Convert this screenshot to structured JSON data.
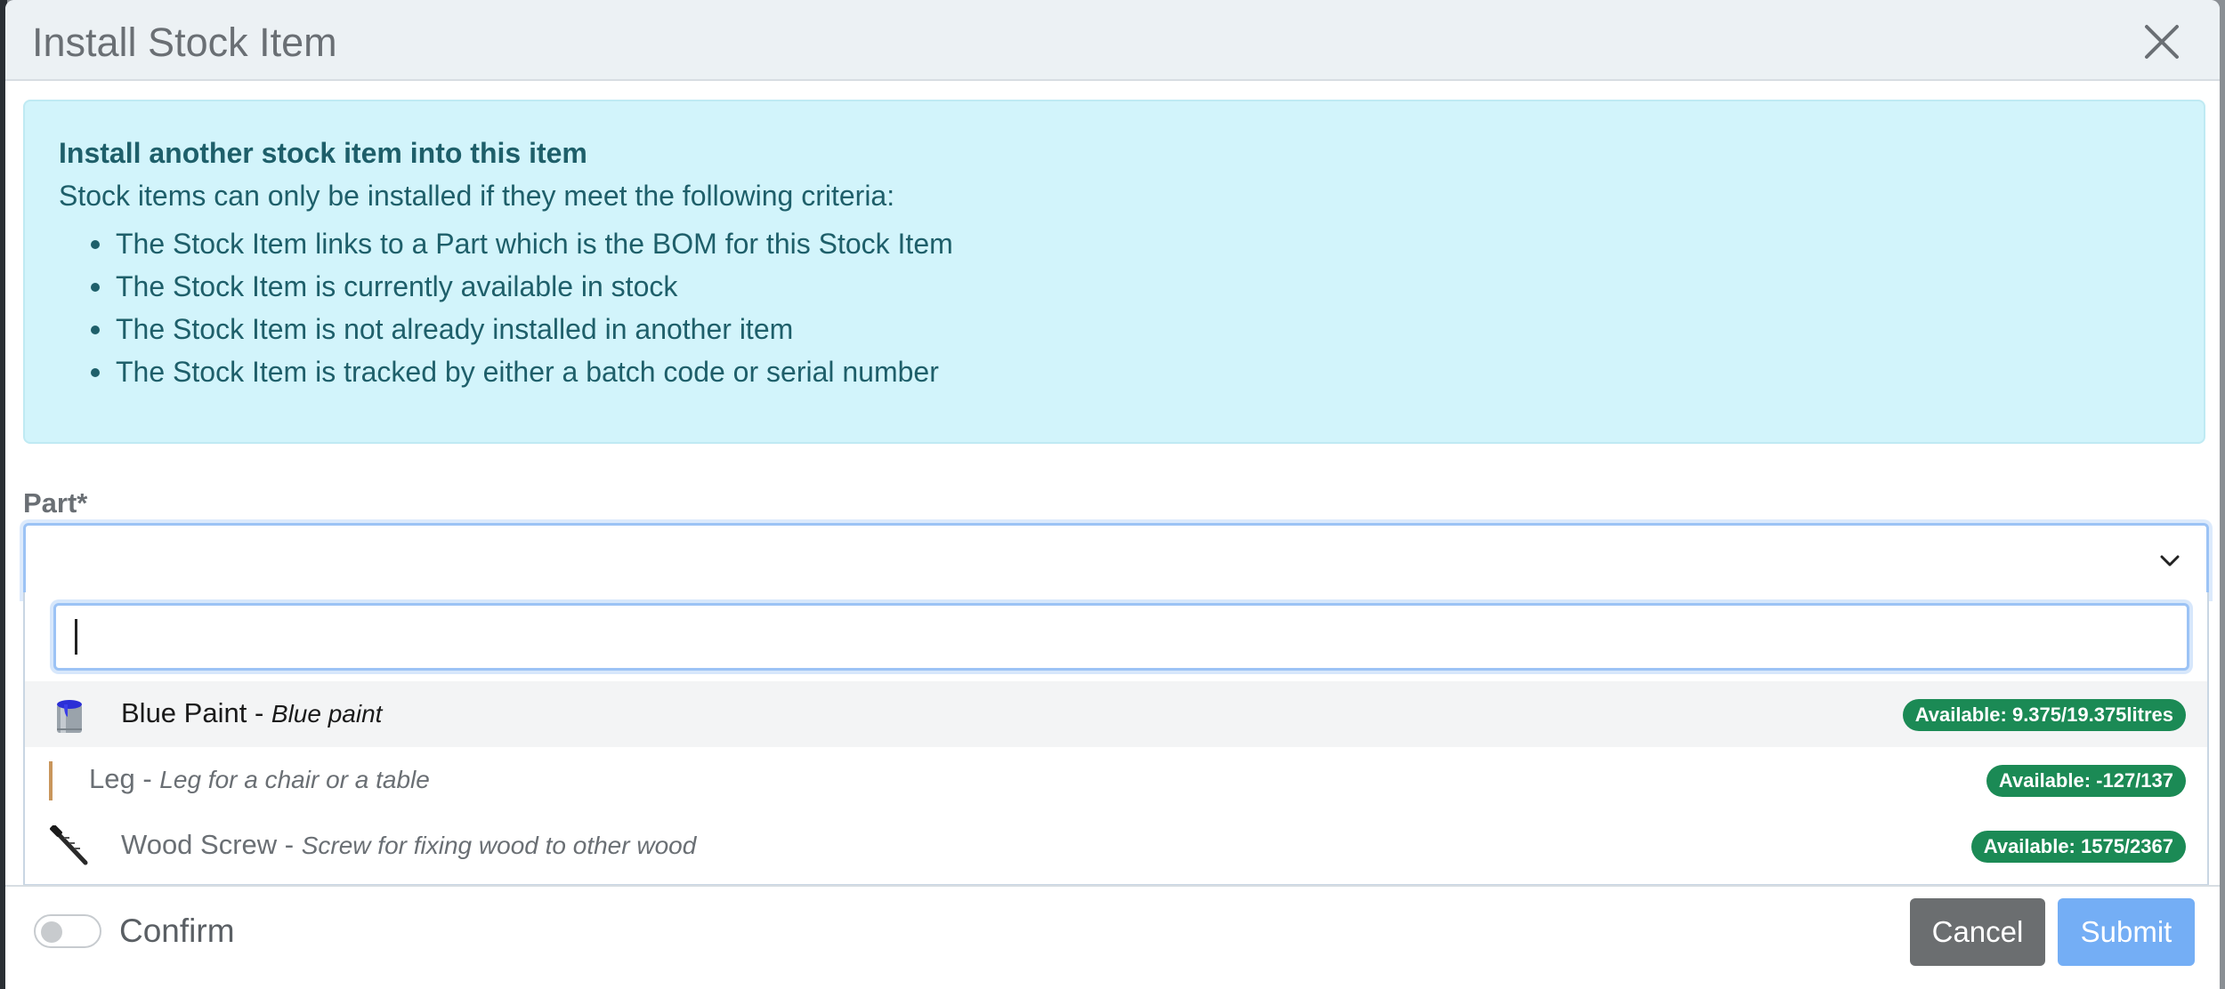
{
  "modal": {
    "title": "Install Stock Item"
  },
  "info": {
    "heading": "Install another stock item into this item",
    "intro": "Stock items can only be installed if they meet the following criteria:",
    "criteria": [
      "The Stock Item links to a Part which is the BOM for this Stock Item",
      "The Stock Item is currently available in stock",
      "The Stock Item is not already installed in another item",
      "The Stock Item is tracked by either a batch code or serial number"
    ]
  },
  "form": {
    "part_label": "Part*",
    "search_value": "",
    "options": [
      {
        "name": "Blue Paint",
        "separator": " - ",
        "description": "Blue paint",
        "badge": "Available: 9.375/19.375litres",
        "icon": "paint-can-icon"
      },
      {
        "name": "Leg",
        "separator": " - ",
        "description": "Leg for a chair or a table",
        "badge": "Available: -127/137",
        "icon": "wood-leg-icon"
      },
      {
        "name": "Wood Screw",
        "separator": " - ",
        "description": "Screw for fixing wood to other wood",
        "badge": "Available: 1575/2367",
        "icon": "screw-icon"
      }
    ],
    "confirm_label": "Confirm",
    "confirm_checked": false
  },
  "footer": {
    "cancel_label": "Cancel",
    "submit_label": "Submit"
  },
  "colors": {
    "info_bg": "#d2f4fb",
    "badge_green": "#1b8a55",
    "submit_blue": "#74aef5",
    "cancel_gray": "#6b6e70"
  }
}
